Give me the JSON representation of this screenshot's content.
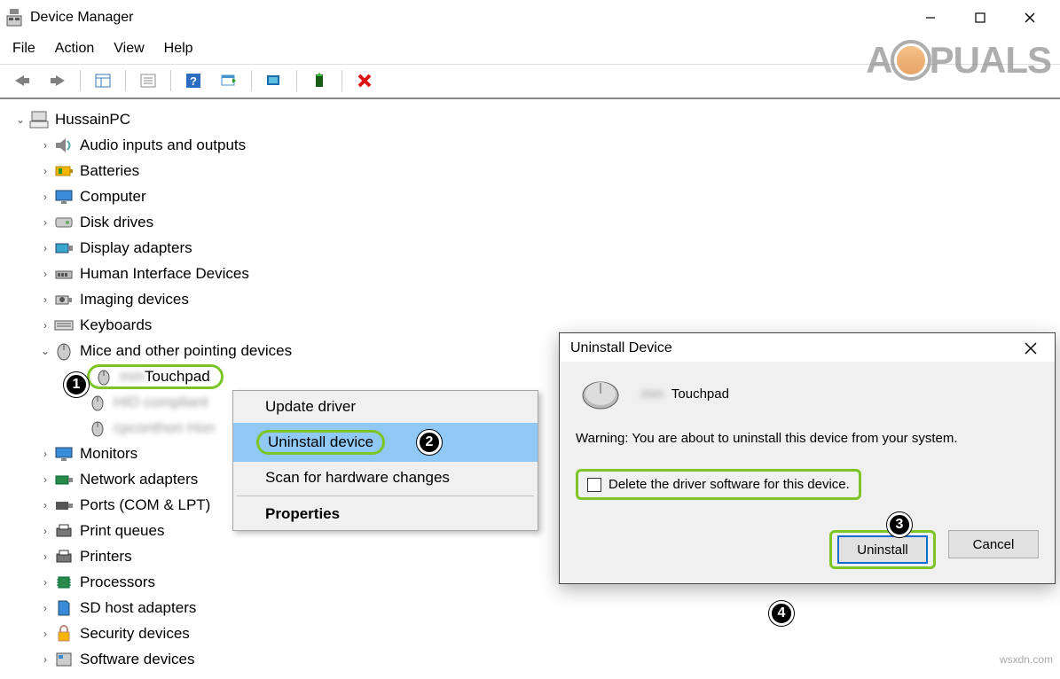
{
  "window": {
    "title": "Device Manager",
    "minimize": "—",
    "maximize": "☐",
    "close": "✕"
  },
  "menu": {
    "file": "File",
    "action": "Action",
    "view": "View",
    "help": "Help"
  },
  "tree": {
    "root": "HussainPC",
    "items": [
      {
        "label": "Audio inputs and outputs"
      },
      {
        "label": "Batteries"
      },
      {
        "label": "Computer"
      },
      {
        "label": "Disk drives"
      },
      {
        "label": "Display adapters"
      },
      {
        "label": "Human Interface Devices"
      },
      {
        "label": "Imaging devices"
      },
      {
        "label": "Keyboards"
      },
      {
        "label": "Mice and other pointing devices",
        "expanded": true
      },
      {
        "label": "Monitors"
      },
      {
        "label": "Network adapters"
      },
      {
        "label": "Ports (COM & LPT)"
      },
      {
        "label": "Print queues"
      },
      {
        "label": "Printers"
      },
      {
        "label": "Processors"
      },
      {
        "label": "SD host adapters"
      },
      {
        "label": "Security devices"
      },
      {
        "label": "Software devices"
      }
    ],
    "mouse_children": {
      "touchpad": "Touchpad",
      "blurred2": "HID compliant",
      "blurred3": "cpconthon Hon"
    }
  },
  "context_menu": {
    "update": "Update driver",
    "uninstall": "Uninstall device",
    "scan": "Scan for hardware changes",
    "properties": "Properties"
  },
  "dialog": {
    "title": "Uninstall Device",
    "device": "Touchpad",
    "warning": "Warning: You are about to uninstall this device from your system.",
    "checkbox": "Delete the driver software for this device.",
    "ok": "Uninstall",
    "cancel": "Cancel"
  },
  "watermark": {
    "pre": "A",
    "post": "PUALS"
  },
  "footer": "wsxdn.com",
  "callouts": {
    "c1": "1",
    "c2": "2",
    "c3": "3",
    "c4": "4"
  }
}
